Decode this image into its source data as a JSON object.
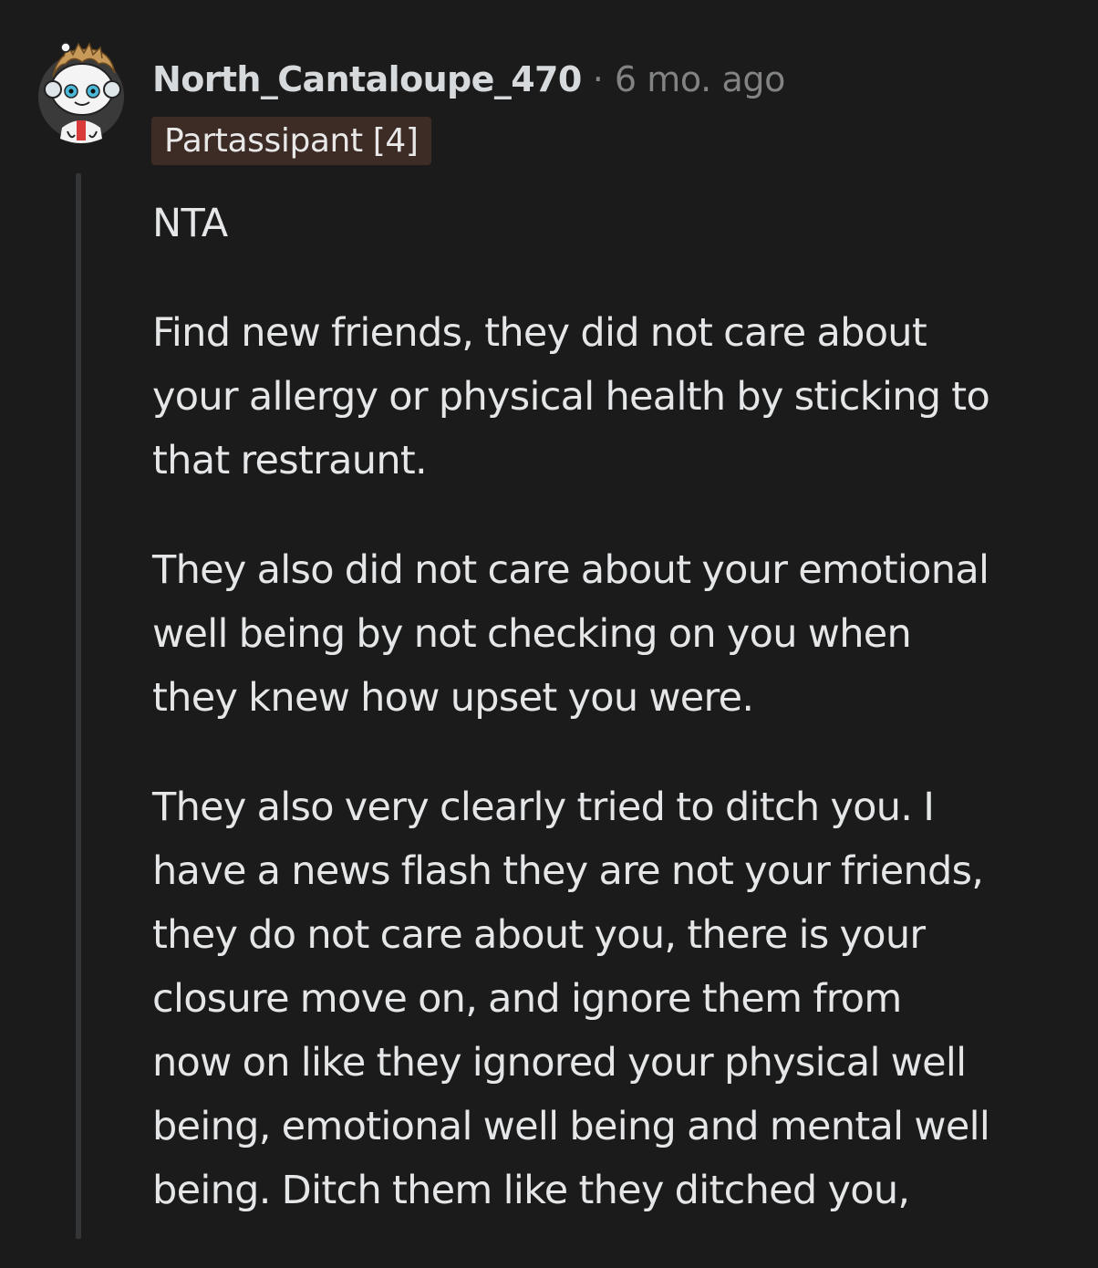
{
  "comment": {
    "author": "North_Cantaloupe_470",
    "separator": "·",
    "timestamp": "6 mo. ago",
    "flair": "Partassipant [4]",
    "paragraphs": [
      [
        "NTA"
      ],
      [
        "Find new friends, they did not care about",
        "your allergy or physical health by sticking to",
        "that restraunt."
      ],
      [
        "They also did not care about your emotional",
        "well being by not checking on you when",
        "they knew how upset you were."
      ],
      [
        "They also very clearly tried to ditch you. I",
        "have a news flash they are not your friends,",
        "they do not care about you, there is your",
        "closure move on, and ignore them from",
        "now on like they ignored your physical well",
        "being, emotional well being and mental well",
        "being. Ditch them like they ditched you,"
      ]
    ]
  },
  "colors": {
    "background": "#1b1b1b",
    "text": "#d7dadc",
    "meta": "#818384",
    "flair_bg": "#3d2b25",
    "thread_line": "#343536"
  },
  "icons": {
    "avatar": "snoo-astronaut-avatar-icon"
  }
}
